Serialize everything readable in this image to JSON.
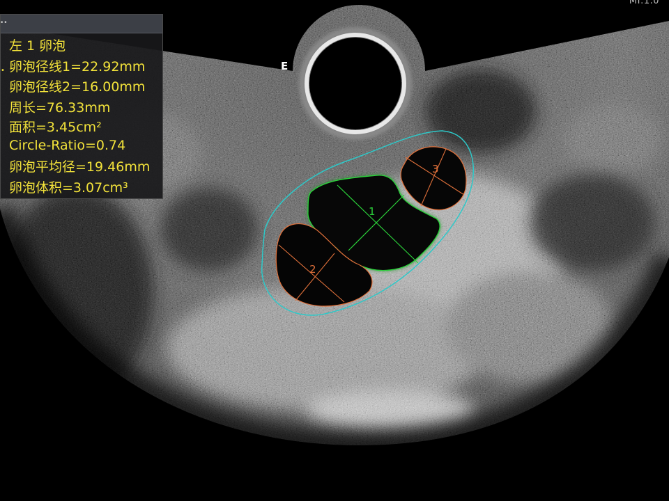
{
  "top_right_readout": "MI:1.0",
  "probe_orientation_marker": "E",
  "measurement_panel": {
    "title": "左 1 卵泡",
    "lines": [
      "卵泡径线1=22.92mm",
      "卵泡径线2=16.00mm",
      "周长=76.33mm",
      "面积=3.45cm²",
      "Circle-Ratio=0.74",
      "卵泡平均径=19.46mm",
      "卵泡体积=3.07cm³"
    ]
  },
  "follicle_labels": [
    "1",
    "2",
    "3"
  ],
  "colors": {
    "measurement_text": "#f2e23a",
    "ovary_outline": "#2ec9c9",
    "follicle_1_outline": "#2bd13a",
    "follicle_2_outline": "#e0703a",
    "follicle_3_outline": "#e0703a"
  }
}
